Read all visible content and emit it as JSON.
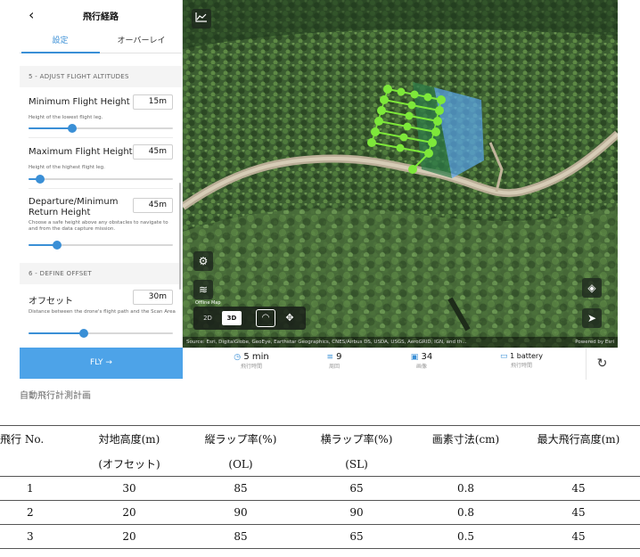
{
  "app": {
    "back_glyph": "‹",
    "title": "飛行経路",
    "tabs": [
      "設定",
      "オーバーレイ"
    ],
    "section1": "5 - ADJUST FLIGHT ALTITUDES",
    "section2": "6 - DEFINE OFFSET",
    "fields": [
      {
        "label": "Minimum Flight Height",
        "value": "15m",
        "desc": "Height of the lowest flight leg.",
        "slider": 0.3
      },
      {
        "label": "Maximum Flight Height",
        "value": "45m",
        "desc": "Height of the highest flight leg.",
        "slider": 0.08
      },
      {
        "label": "Departure/Minimum Return Height",
        "value": "45m",
        "desc": "Choose a safe height above any obstacles to navigate to and from the data capture mission.",
        "slider": 0.2
      },
      {
        "label": "オフセット",
        "value": "30m",
        "desc": "Distance between the drone's flight path and the Scan Area",
        "slider": 0.38
      }
    ],
    "fly_label": "FLY →",
    "map": {
      "offline_label": "Offline Map",
      "toggle_2d": "2D",
      "toggle_3d": "3D",
      "attribution": "Source: Esri, DigitalGlobe, GeoEye, Earthstar Geographics, CNES/Airbus DS, USDA, USGS, AeroGRID, IGN, and th...",
      "attribution_right": "Powered by Esri"
    },
    "stats": [
      {
        "icon": "clock-icon",
        "value": "5 min",
        "label": "飛行時間"
      },
      {
        "icon": "passes-icon",
        "value": "9",
        "label": "周回"
      },
      {
        "icon": "image-icon",
        "value": "34",
        "label": "画像"
      },
      {
        "icon": "battery-icon",
        "value": "1 battery",
        "label": "飛行時間"
      }
    ],
    "colors": {
      "accent": "#3a8fd6",
      "fly_button": "#4da3e8",
      "flight_path": "#7ee83a"
    }
  },
  "caption": "自動飛行計測計画",
  "table": {
    "headers_line1": [
      "飛行 No.",
      "対地高度(m)",
      "縦ラップ率(%)",
      "横ラップ率(%)",
      "画素寸法(cm)",
      "最大飛行高度(m)"
    ],
    "headers_line2": [
      "",
      "(オフセット)",
      "(OL)",
      "(SL)",
      "",
      ""
    ],
    "rows": [
      [
        "1",
        "30",
        "85",
        "65",
        "0.8",
        "45"
      ],
      [
        "2",
        "20",
        "90",
        "90",
        "0.8",
        "45"
      ],
      [
        "3",
        "20",
        "85",
        "65",
        "0.5",
        "45"
      ]
    ]
  }
}
